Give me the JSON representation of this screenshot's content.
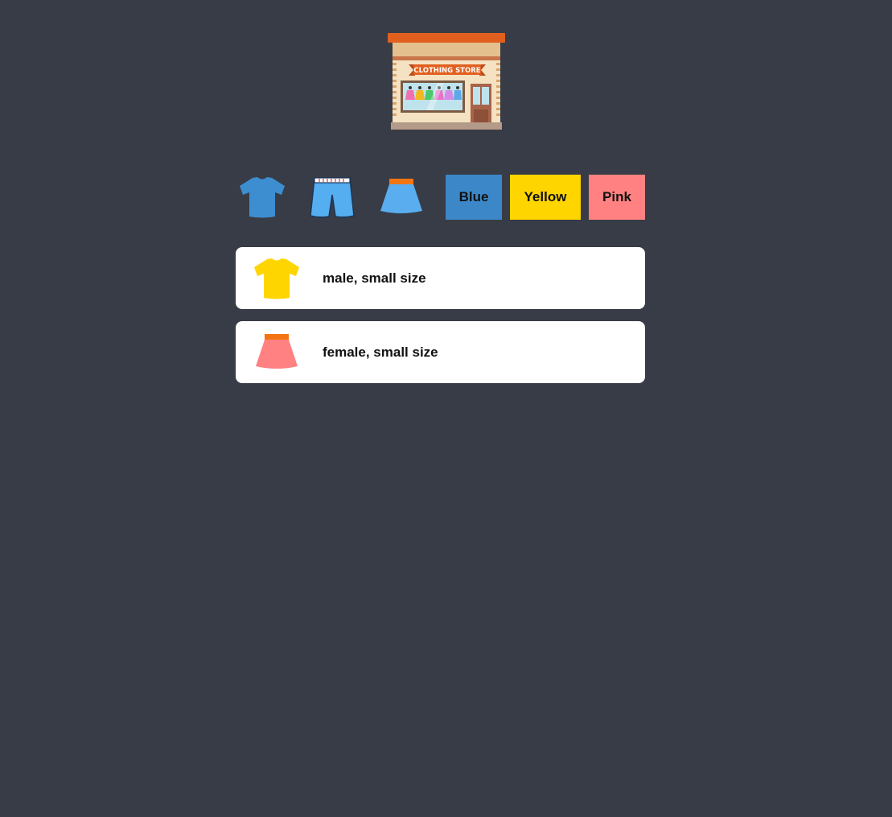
{
  "header": {
    "logo_icon": "clothing-store-icon",
    "sign_text": "CLOTHING STORE"
  },
  "garments": [
    {
      "name": "shirt",
      "icon": "tshirt-icon",
      "color": "#3d8ed1"
    },
    {
      "name": "shorts",
      "icon": "shorts-icon",
      "color": "#55aef0"
    },
    {
      "name": "skirt",
      "icon": "skirt-icon",
      "color": "#5aaef0"
    }
  ],
  "colors": [
    {
      "label": "Blue",
      "hex": "#3b87c8"
    },
    {
      "label": "Yellow",
      "hex": "#ffd500"
    },
    {
      "label": "Pink",
      "hex": "#ff8181"
    }
  ],
  "results": [
    {
      "icon": "tshirt-icon",
      "color": "#ffd500",
      "text": "male, small size"
    },
    {
      "icon": "skirt-icon",
      "color": "#ff8181",
      "text": "female, small size"
    }
  ]
}
